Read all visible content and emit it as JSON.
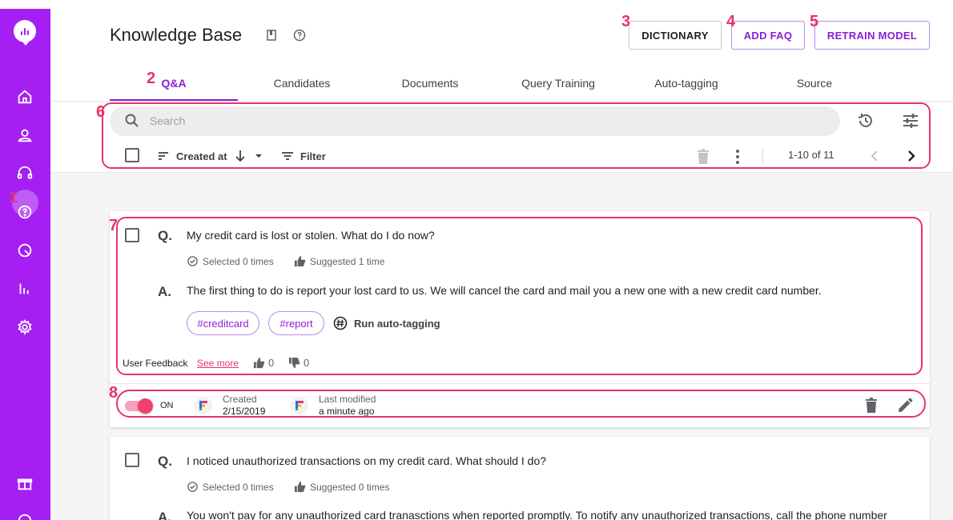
{
  "header": {
    "title": "Knowledge Base",
    "buttons": {
      "dictionary": "DICTIONARY",
      "add_faq": "ADD FAQ",
      "retrain_model": "RETRAIN MODEL"
    }
  },
  "sidebar": {
    "items": [
      {
        "icon": "home-icon"
      },
      {
        "icon": "user-icon"
      },
      {
        "icon": "chat-support-icon"
      },
      {
        "icon": "help-circle-icon",
        "active": true
      },
      {
        "icon": "search-chat-icon"
      },
      {
        "icon": "analytics-icon"
      },
      {
        "icon": "settings-icon"
      },
      {
        "icon": "gift-icon"
      },
      {
        "icon": "help-icon"
      }
    ]
  },
  "tabs": [
    {
      "label": "Q&A",
      "active": true
    },
    {
      "label": "Candidates"
    },
    {
      "label": "Documents"
    },
    {
      "label": "Query Training"
    },
    {
      "label": "Auto-tagging"
    },
    {
      "label": "Source"
    }
  ],
  "toolbar": {
    "search_placeholder": "Search",
    "sort_label": "Created at",
    "filter_label": "Filter",
    "pagination": "1-10 of 11"
  },
  "items": [
    {
      "q_letter": "Q.",
      "question": "My credit card is lost or stolen. What do I do now?",
      "selected": "Selected 0 times",
      "suggested": "Suggested 1 time",
      "a_letter": "A.",
      "answer": "The first thing to do is report your lost card to us. We will cancel the card and mail you a new one with a new credit card number.",
      "tags": [
        "#creditcard",
        "#report"
      ],
      "run_auto_tagging": "Run auto-tagging",
      "feedback_label": "User Feedback",
      "see_more": "See more",
      "thumbs_up": "0",
      "thumbs_down": "0",
      "toggle_label": "ON",
      "created_label": "Created",
      "created_value": "2/15/2019",
      "modified_label": "Last modified",
      "modified_value": "a minute ago"
    },
    {
      "q_letter": "Q.",
      "question": "I noticed unauthorized transactions on my credit card. What should I do?",
      "selected": "Selected 0 times",
      "suggested": "Suggested 0 times",
      "a_letter": "A.",
      "answer": "You won't pay for any unauthorized card tranasctions when reported promptly. To notify any unauthorized transactions, call the phone number"
    }
  ],
  "annotations": [
    "1",
    "2",
    "3",
    "4",
    "5",
    "6",
    "7",
    "8"
  ],
  "colors": {
    "sidebar": "#a51ff2",
    "accent": "#8a1ed8",
    "annotation": "#e6336b",
    "toggle_on": "#f2406e"
  }
}
